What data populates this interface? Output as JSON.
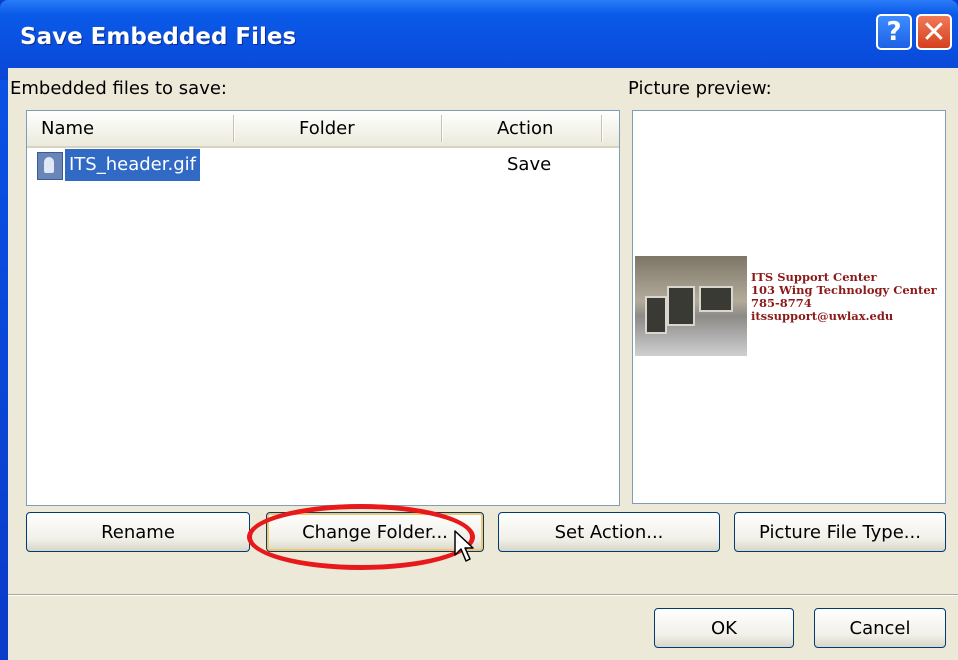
{
  "window": {
    "title": "Save Embedded Files",
    "help_label": "?",
    "close_label": "✕"
  },
  "embedded_files_label": "Embedded files to save:",
  "picture_preview_label": "Picture preview:",
  "list": {
    "columns": [
      "Name",
      "Folder",
      "Action"
    ],
    "rows": [
      {
        "name": "ITS_header.gif",
        "folder": "",
        "action": "Save",
        "selected": true,
        "icon": "image-file-icon"
      }
    ]
  },
  "preview": {
    "lines": [
      "ITS Support Center",
      "103 Wing Technology Center",
      "785-8774",
      "itssupport@uwlax.edu"
    ]
  },
  "buttons": {
    "rename": "Rename",
    "change_folder": "Change Folder...",
    "set_action": "Set Action...",
    "picture_file_type": "Picture File Type...",
    "ok": "OK",
    "cancel": "Cancel"
  },
  "colors": {
    "title_bar": "#0a4fe0",
    "selection": "#316ac5",
    "annotation_oval": "#e8191b"
  }
}
